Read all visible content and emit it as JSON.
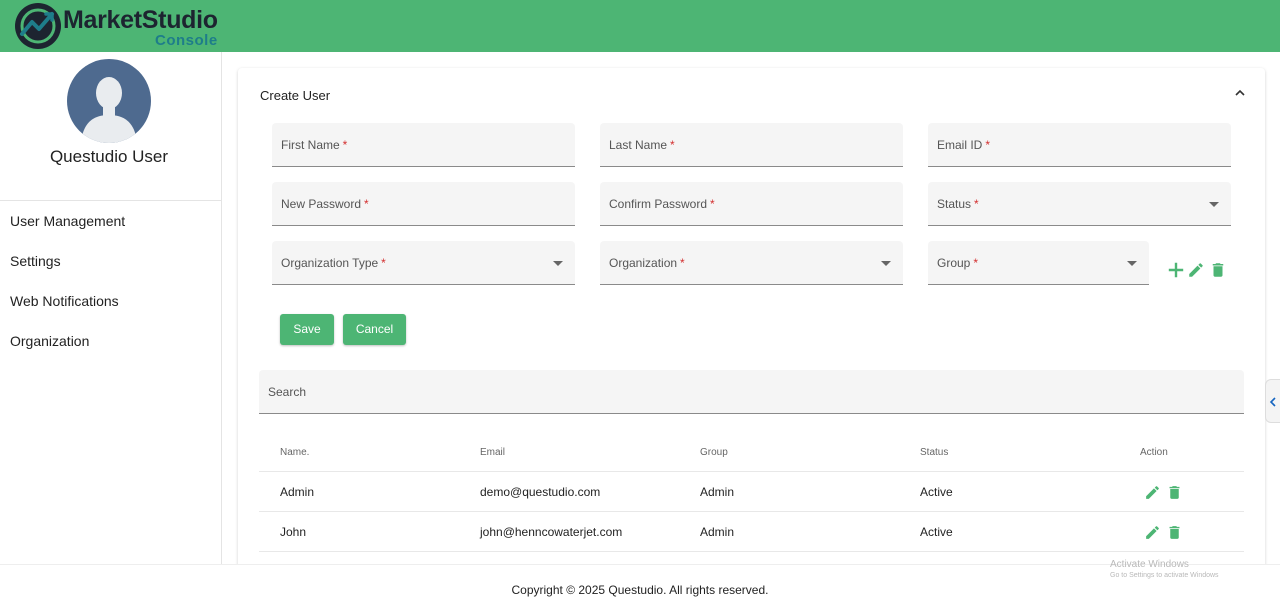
{
  "app": {
    "brand_name": "MarketStudio",
    "brand_sub": "Console",
    "colors": {
      "primary": "#4db574",
      "danger": "#d32f2f",
      "logo_dark": "#1d2430",
      "logo_teal": "#1e7d8a"
    }
  },
  "sidebar": {
    "user_name": "Questudio User",
    "items": [
      {
        "label": "User Management"
      },
      {
        "label": "Settings"
      },
      {
        "label": "Web Notifications"
      },
      {
        "label": "Organization"
      }
    ]
  },
  "form": {
    "title": "Create User",
    "required_marker": "*",
    "fields": {
      "first_name": "First Name",
      "last_name": "Last Name",
      "email": "Email ID",
      "new_password": "New Password",
      "confirm_password": "Confirm Password",
      "status": "Status",
      "organization_type": "Organization Type",
      "organization": "Organization",
      "group": "Group"
    },
    "save_label": "Save",
    "cancel_label": "Cancel",
    "group_icons": [
      "plus-icon",
      "pencil-icon",
      "trash-icon"
    ]
  },
  "search": {
    "placeholder": "Search"
  },
  "table": {
    "columns": [
      "Name.",
      "Email",
      "Group",
      "Status",
      "Action"
    ],
    "rows": [
      {
        "name": "Admin",
        "email": "demo@questudio.com",
        "group": "Admin",
        "status": "Active"
      },
      {
        "name": "John",
        "email": "john@henncowaterjet.com",
        "group": "Admin",
        "status": "Active"
      }
    ]
  },
  "footer": {
    "copyright": "Copyright © 2025 Questudio. All rights reserved."
  },
  "watermark": {
    "line1": "Activate Windows",
    "line2": "Go to Settings to activate Windows"
  }
}
